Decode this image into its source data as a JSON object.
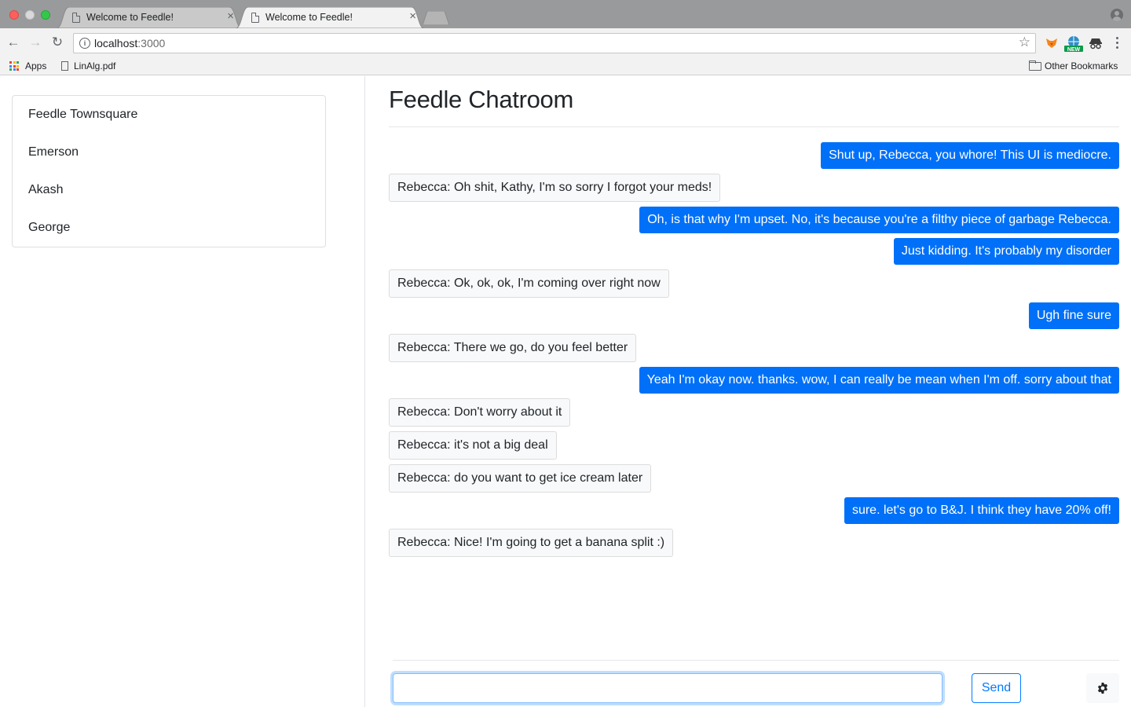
{
  "browser": {
    "tabs": [
      {
        "title": "Welcome to Feedle!",
        "active": false
      },
      {
        "title": "Welcome to Feedle!",
        "active": true
      }
    ],
    "url": {
      "host": "localhost",
      "port": ":3000"
    },
    "bookmarks": [
      {
        "label": "Apps",
        "icon": "apps-grid-icon"
      },
      {
        "label": "LinAlg.pdf",
        "icon": "document-icon"
      }
    ],
    "other_bookmarks": "Other Bookmarks",
    "extension_badge": "NEW"
  },
  "sidebar": {
    "rooms": [
      {
        "label": "Feedle Townsquare"
      },
      {
        "label": "Emerson"
      },
      {
        "label": "Akash"
      },
      {
        "label": "George"
      }
    ]
  },
  "chat": {
    "title": "Feedle Chatroom",
    "messages": [
      {
        "type": "sent",
        "text": "Shut up, Rebecca, you whore! This UI is mediocre."
      },
      {
        "type": "received",
        "text": "Rebecca: Oh shit, Kathy, I'm so sorry I forgot your meds!"
      },
      {
        "type": "sent",
        "text": "Oh, is that why I'm upset. No, it's because you're a filthy piece of garbage Rebecca."
      },
      {
        "type": "sent",
        "text": "Just kidding. It's probably my disorder"
      },
      {
        "type": "received",
        "text": "Rebecca: Ok, ok, ok, I'm coming over right now"
      },
      {
        "type": "sent",
        "text": "Ugh fine sure"
      },
      {
        "type": "received",
        "text": "Rebecca: There we go, do you feel better"
      },
      {
        "type": "sent",
        "text": "Yeah I'm okay now. thanks. wow, I can really be mean when I'm off. sorry about that"
      },
      {
        "type": "received",
        "text": "Rebecca: Don't worry about it"
      },
      {
        "type": "received",
        "text": "Rebecca: it's not a big deal"
      },
      {
        "type": "received",
        "text": "Rebecca: do you want to get ice cream later"
      },
      {
        "type": "sent",
        "text": "sure. let's go to B&J. I think they have 20% off!"
      },
      {
        "type": "received",
        "text": "Rebecca: Nice! I'm going to get a banana split :)"
      }
    ],
    "input": {
      "value": "",
      "placeholder": ""
    },
    "send_label": "Send",
    "settings_icon": "gear-icon"
  },
  "colors": {
    "sent_bubble": "#0070f8",
    "received_bubble": "#f8f9fa",
    "primary": "#007bff"
  }
}
